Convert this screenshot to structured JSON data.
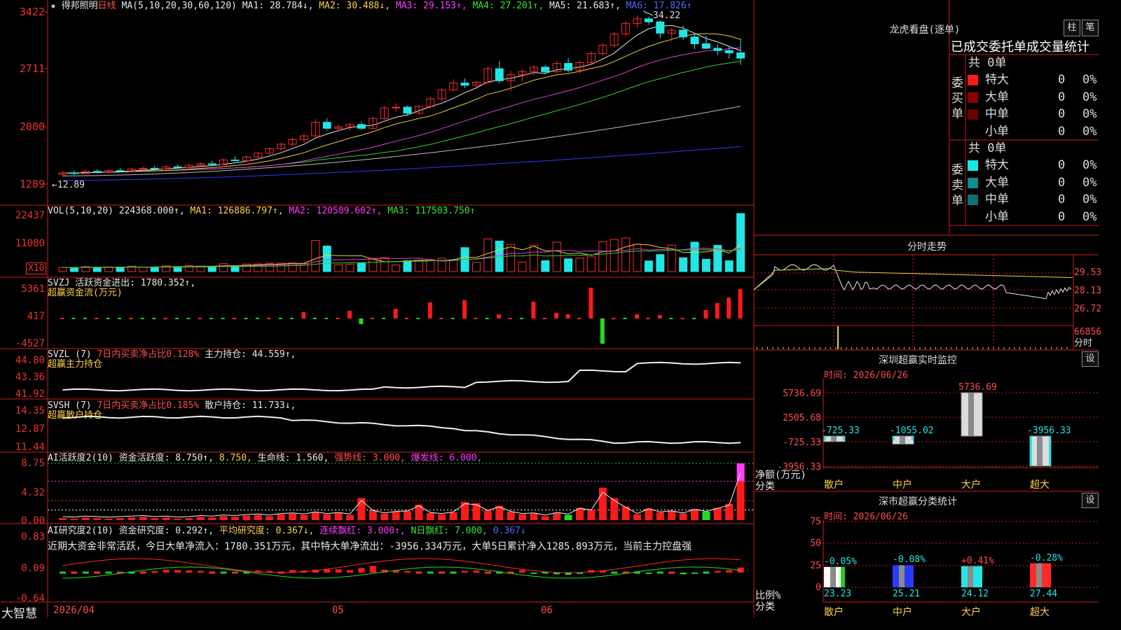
{
  "header": {
    "stock_name": "得邦照明",
    "period": "日线",
    "ma_label": "MA(5,10,20,30,60,120)",
    "ma": [
      {
        "label": "MA1:",
        "value": "28.784",
        "arrow": "↓",
        "color": "#e8e8e8"
      },
      {
        "label": "MA2:",
        "value": "30.488",
        "arrow": "↓",
        "color": "#ffd24a"
      },
      {
        "label": "MA3:",
        "value": "29.153",
        "arrow": "↑",
        "color": "#ff3cff"
      },
      {
        "label": "MA4:",
        "value": "27.201",
        "arrow": "↑",
        "color": "#33e633"
      },
      {
        "label": "MA5:",
        "value": "21.683",
        "arrow": "↑",
        "color": "#e8e8e8"
      },
      {
        "label": "MA6:",
        "value": "17.826",
        "arrow": "↑",
        "color": "#4a6bff"
      }
    ]
  },
  "price_panel": {
    "y_ticks": [
      "3422",
      "2711",
      "2000",
      "1289"
    ],
    "high_label": "34.22",
    "low_label": "←12.89"
  },
  "vol_panel": {
    "label": "VOL(5,10,20)",
    "value": "224368.000↑,",
    "ma": [
      {
        "text": "MA1: 126886.797↑,",
        "color": "#ffd24a"
      },
      {
        "text": "MA2: 120589.602↑,",
        "color": "#ff3cff"
      },
      {
        "text": "MA3: 117503.750↑",
        "color": "#33e633"
      }
    ],
    "y_ticks": [
      "22437",
      "11080"
    ],
    "unit": "X10"
  },
  "svzj_panel": {
    "label": "SVZJ  活跃资金进出: 1780.352↑,",
    "sub": "超赢资金流(万元)",
    "y_ticks": [
      "5361",
      "417",
      "-4527"
    ]
  },
  "svzl_panel": {
    "label": "SVZL (7)",
    "pct": "7日内买卖净占比0.128%",
    "hold": "主力持仓: 44.559↑,",
    "sub": "超赢主力持仓",
    "y_ticks": [
      "44.80",
      "43.36",
      "41.92"
    ]
  },
  "svsh_panel": {
    "label": "SVSH (7)",
    "pct": "7日内买卖净占比0.185%",
    "hold": "散户持仓: 11.733↓,",
    "sub": "超赢散户持仓",
    "y_ticks": [
      "14.35",
      "12.87",
      "11.44"
    ]
  },
  "ai_panel": {
    "label": "AI活跃度2(10)",
    "degree": "资金活跃度: 8.750↑,",
    "degree2": "8.750,",
    "life": "生命线: 1.560,",
    "strong": "强势线: 3.000,",
    "burst": "爆发线: 6.000,",
    "y_ticks": [
      "8.75",
      "4.32",
      "0.00"
    ]
  },
  "research_panel": {
    "label": "AI研究度2(10)",
    "degree": "资金研究度: 0.292↑,",
    "avg": "平均研究度: 0.367↓,",
    "cont": "连续飘红: 3.000↑,",
    "nday": "N日飘红: 7.000,",
    "v": "0.367↓",
    "comment": "近期大资金非常活跃，今日大单净流入：1780.351万元，其中特大单净流出：-3956.334万元，大单5日累计净入1285.893万元，当前主力控盘强",
    "y_ticks": [
      "0.83",
      "0.09",
      "-0.64"
    ]
  },
  "bottom_axis": {
    "app_name": "大智慧",
    "dates": [
      "2026/04",
      "05",
      "06"
    ]
  },
  "right_panel": {
    "lhb_title": "龙虎看盘(逐单)",
    "btn_bar": "柱",
    "btn_pen": "笔",
    "tabs": "已成交委托单成交量统计",
    "buy_label": "委买单",
    "sell_label": "委卖单",
    "buy_total": "共 0单",
    "sell_total": "共 0单",
    "buy_rows": [
      {
        "name": "特大",
        "val": "0",
        "pct": "0%",
        "color": "#ff1a1a"
      },
      {
        "name": "大单",
        "val": "0",
        "pct": "0%",
        "color": "#8b0000"
      },
      {
        "name": "中单",
        "val": "0",
        "pct": "0%",
        "color": "#6b0000"
      },
      {
        "name": "小单",
        "val": "0",
        "pct": "0%",
        "color": "#000000"
      }
    ],
    "sell_rows": [
      {
        "name": "特大",
        "val": "0",
        "pct": "0%",
        "color": "#1ae6e6"
      },
      {
        "name": "大单",
        "val": "0",
        "pct": "0%",
        "color": "#0f8c8c"
      },
      {
        "name": "中单",
        "val": "0",
        "pct": "0%",
        "color": "#0b7070"
      },
      {
        "name": "小单",
        "val": "0",
        "pct": "0%",
        "color": "#000000"
      }
    ],
    "intraday_title": "分时走势",
    "intraday_ticks": [
      "29.53",
      "28.13",
      "26.72",
      "66856"
    ],
    "intraday_unit": "分时",
    "sz_monitor_title": "深圳超赢实时监控",
    "sz_monitor_time": "时间: 2026/06/26",
    "set_btn": "设",
    "monitor_y": [
      "5736.69",
      "2505.68",
      "-725.33",
      "-3956.33"
    ],
    "monitor_unit": "净额(万元)",
    "monitor_unit2": "分类",
    "monitor_bars": [
      {
        "cat": "散户",
        "value": -725.33,
        "label": "-725.33"
      },
      {
        "cat": "中户",
        "value": -1055.02,
        "label": "-1055.02"
      },
      {
        "cat": "大户",
        "value": 5736.69,
        "label": "5736.69"
      },
      {
        "cat": "超大",
        "value": -3956.33,
        "label": "-3956.33"
      }
    ],
    "sz_class_title": "深市超赢分类统计",
    "sz_class_time": "时间: 2026/06/26",
    "class_y": [
      "75",
      "50",
      "25",
      "0"
    ],
    "class_unit": "比例%",
    "class_unit2": "分类",
    "class_bars": [
      {
        "cat": "散户",
        "value": 23.23,
        "change": "-0.05%",
        "color": "#ffffff",
        "accent": "#22cc22"
      },
      {
        "cat": "中户",
        "value": 25.21,
        "change": "-0.08%",
        "color": "#2a3bff",
        "accent": "#2a3bff"
      },
      {
        "cat": "大户",
        "value": 24.12,
        "change": "+0.41%",
        "color": "#22e6e6",
        "accent": "#22e6e6"
      },
      {
        "cat": "超大",
        "value": 27.44,
        "change": "-0.28%",
        "color": "#ff2a2a",
        "accent": "#ff2a2a"
      }
    ]
  },
  "chart_data": [
    {
      "type": "candlestick",
      "title": "得邦照明 日线",
      "ylim": [
        12.0,
        35.0
      ],
      "candles_ohlc": [
        [
          13.2,
          13.6,
          12.89,
          13.4
        ],
        [
          13.4,
          13.7,
          13.1,
          13.3
        ],
        [
          13.3,
          13.8,
          13.2,
          13.6
        ],
        [
          13.6,
          13.9,
          13.4,
          13.5
        ],
        [
          13.5,
          13.9,
          13.3,
          13.7
        ],
        [
          13.7,
          14.0,
          13.5,
          13.6
        ],
        [
          13.6,
          14.1,
          13.5,
          13.9
        ],
        [
          13.9,
          14.2,
          13.7,
          14.0
        ],
        [
          14.0,
          14.3,
          13.8,
          13.9
        ],
        [
          13.9,
          14.4,
          13.8,
          14.2
        ],
        [
          14.2,
          14.5,
          14.0,
          14.1
        ],
        [
          14.1,
          14.6,
          14.0,
          14.4
        ],
        [
          14.4,
          14.8,
          14.2,
          14.6
        ],
        [
          14.6,
          15.0,
          14.4,
          14.5
        ],
        [
          14.5,
          15.3,
          14.4,
          15.1
        ],
        [
          15.1,
          15.6,
          14.9,
          15.0
        ],
        [
          15.0,
          15.7,
          14.9,
          15.5
        ],
        [
          15.5,
          16.2,
          15.3,
          16.0
        ],
        [
          16.0,
          16.8,
          15.8,
          16.6
        ],
        [
          16.6,
          17.4,
          16.3,
          17.2
        ],
        [
          17.2,
          18.0,
          16.9,
          17.8
        ],
        [
          17.8,
          18.6,
          17.4,
          18.3
        ],
        [
          18.3,
          20.5,
          18.0,
          20.1
        ],
        [
          20.1,
          20.6,
          19.0,
          19.3
        ],
        [
          19.3,
          19.8,
          18.9,
          19.5
        ],
        [
          19.5,
          20.0,
          19.0,
          19.8
        ],
        [
          19.8,
          20.2,
          19.1,
          19.3
        ],
        [
          19.3,
          20.8,
          19.2,
          20.6
        ],
        [
          20.6,
          22.3,
          20.4,
          22.0
        ],
        [
          22.0,
          22.6,
          21.5,
          22.1
        ],
        [
          22.1,
          22.3,
          21.0,
          21.3
        ],
        [
          21.3,
          22.4,
          21.1,
          22.2
        ],
        [
          22.2,
          23.5,
          21.9,
          23.2
        ],
        [
          23.2,
          24.6,
          22.9,
          24.4
        ],
        [
          24.4,
          25.8,
          24.1,
          25.3
        ],
        [
          25.3,
          25.9,
          24.6,
          25.0
        ],
        [
          25.0,
          25.6,
          24.5,
          25.4
        ],
        [
          25.4,
          27.5,
          25.1,
          27.2
        ],
        [
          27.2,
          28.2,
          25.3,
          25.6
        ],
        [
          25.6,
          26.9,
          24.2,
          26.4
        ],
        [
          26.4,
          27.1,
          25.5,
          26.8
        ],
        [
          26.8,
          27.7,
          26.3,
          27.4
        ],
        [
          27.4,
          27.7,
          26.4,
          26.8
        ],
        [
          26.8,
          28.2,
          26.6,
          27.9
        ],
        [
          27.9,
          28.6,
          26.7,
          27.0
        ],
        [
          27.0,
          28.3,
          26.6,
          28.0
        ],
        [
          28.0,
          29.5,
          27.7,
          29.2
        ],
        [
          29.2,
          30.6,
          28.9,
          30.3
        ],
        [
          30.3,
          32.1,
          30.0,
          31.8
        ],
        [
          31.8,
          33.5,
          31.4,
          33.2
        ],
        [
          33.2,
          34.22,
          32.6,
          33.8
        ],
        [
          33.8,
          34.1,
          33.0,
          33.4
        ],
        [
          33.4,
          33.6,
          31.2,
          31.9
        ],
        [
          31.9,
          32.6,
          30.8,
          32.3
        ],
        [
          32.3,
          32.9,
          31.0,
          31.4
        ],
        [
          31.4,
          31.8,
          29.8,
          30.5
        ],
        [
          30.5,
          31.6,
          29.8,
          29.9
        ],
        [
          29.9,
          30.4,
          29.0,
          29.6
        ],
        [
          29.6,
          30.1,
          28.5,
          29.3
        ],
        [
          29.3,
          31.2,
          27.7,
          28.6
        ]
      ]
    }
  ]
}
